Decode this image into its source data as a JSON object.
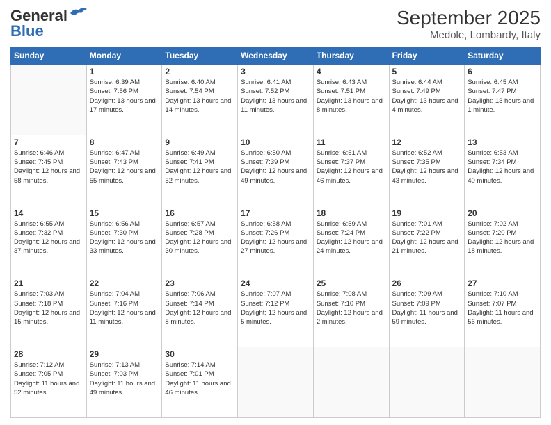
{
  "header": {
    "logo_line1": "General",
    "logo_line2": "Blue",
    "title": "September 2025",
    "subtitle": "Medole, Lombardy, Italy"
  },
  "weekdays": [
    "Sunday",
    "Monday",
    "Tuesday",
    "Wednesday",
    "Thursday",
    "Friday",
    "Saturday"
  ],
  "weeks": [
    [
      {
        "day": "",
        "sunrise": "",
        "sunset": "",
        "daylight": ""
      },
      {
        "day": "1",
        "sunrise": "Sunrise: 6:39 AM",
        "sunset": "Sunset: 7:56 PM",
        "daylight": "Daylight: 13 hours and 17 minutes."
      },
      {
        "day": "2",
        "sunrise": "Sunrise: 6:40 AM",
        "sunset": "Sunset: 7:54 PM",
        "daylight": "Daylight: 13 hours and 14 minutes."
      },
      {
        "day": "3",
        "sunrise": "Sunrise: 6:41 AM",
        "sunset": "Sunset: 7:52 PM",
        "daylight": "Daylight: 13 hours and 11 minutes."
      },
      {
        "day": "4",
        "sunrise": "Sunrise: 6:43 AM",
        "sunset": "Sunset: 7:51 PM",
        "daylight": "Daylight: 13 hours and 8 minutes."
      },
      {
        "day": "5",
        "sunrise": "Sunrise: 6:44 AM",
        "sunset": "Sunset: 7:49 PM",
        "daylight": "Daylight: 13 hours and 4 minutes."
      },
      {
        "day": "6",
        "sunrise": "Sunrise: 6:45 AM",
        "sunset": "Sunset: 7:47 PM",
        "daylight": "Daylight: 13 hours and 1 minute."
      }
    ],
    [
      {
        "day": "7",
        "sunrise": "Sunrise: 6:46 AM",
        "sunset": "Sunset: 7:45 PM",
        "daylight": "Daylight: 12 hours and 58 minutes."
      },
      {
        "day": "8",
        "sunrise": "Sunrise: 6:47 AM",
        "sunset": "Sunset: 7:43 PM",
        "daylight": "Daylight: 12 hours and 55 minutes."
      },
      {
        "day": "9",
        "sunrise": "Sunrise: 6:49 AM",
        "sunset": "Sunset: 7:41 PM",
        "daylight": "Daylight: 12 hours and 52 minutes."
      },
      {
        "day": "10",
        "sunrise": "Sunrise: 6:50 AM",
        "sunset": "Sunset: 7:39 PM",
        "daylight": "Daylight: 12 hours and 49 minutes."
      },
      {
        "day": "11",
        "sunrise": "Sunrise: 6:51 AM",
        "sunset": "Sunset: 7:37 PM",
        "daylight": "Daylight: 12 hours and 46 minutes."
      },
      {
        "day": "12",
        "sunrise": "Sunrise: 6:52 AM",
        "sunset": "Sunset: 7:35 PM",
        "daylight": "Daylight: 12 hours and 43 minutes."
      },
      {
        "day": "13",
        "sunrise": "Sunrise: 6:53 AM",
        "sunset": "Sunset: 7:34 PM",
        "daylight": "Daylight: 12 hours and 40 minutes."
      }
    ],
    [
      {
        "day": "14",
        "sunrise": "Sunrise: 6:55 AM",
        "sunset": "Sunset: 7:32 PM",
        "daylight": "Daylight: 12 hours and 37 minutes."
      },
      {
        "day": "15",
        "sunrise": "Sunrise: 6:56 AM",
        "sunset": "Sunset: 7:30 PM",
        "daylight": "Daylight: 12 hours and 33 minutes."
      },
      {
        "day": "16",
        "sunrise": "Sunrise: 6:57 AM",
        "sunset": "Sunset: 7:28 PM",
        "daylight": "Daylight: 12 hours and 30 minutes."
      },
      {
        "day": "17",
        "sunrise": "Sunrise: 6:58 AM",
        "sunset": "Sunset: 7:26 PM",
        "daylight": "Daylight: 12 hours and 27 minutes."
      },
      {
        "day": "18",
        "sunrise": "Sunrise: 6:59 AM",
        "sunset": "Sunset: 7:24 PM",
        "daylight": "Daylight: 12 hours and 24 minutes."
      },
      {
        "day": "19",
        "sunrise": "Sunrise: 7:01 AM",
        "sunset": "Sunset: 7:22 PM",
        "daylight": "Daylight: 12 hours and 21 minutes."
      },
      {
        "day": "20",
        "sunrise": "Sunrise: 7:02 AM",
        "sunset": "Sunset: 7:20 PM",
        "daylight": "Daylight: 12 hours and 18 minutes."
      }
    ],
    [
      {
        "day": "21",
        "sunrise": "Sunrise: 7:03 AM",
        "sunset": "Sunset: 7:18 PM",
        "daylight": "Daylight: 12 hours and 15 minutes."
      },
      {
        "day": "22",
        "sunrise": "Sunrise: 7:04 AM",
        "sunset": "Sunset: 7:16 PM",
        "daylight": "Daylight: 12 hours and 11 minutes."
      },
      {
        "day": "23",
        "sunrise": "Sunrise: 7:06 AM",
        "sunset": "Sunset: 7:14 PM",
        "daylight": "Daylight: 12 hours and 8 minutes."
      },
      {
        "day": "24",
        "sunrise": "Sunrise: 7:07 AM",
        "sunset": "Sunset: 7:12 PM",
        "daylight": "Daylight: 12 hours and 5 minutes."
      },
      {
        "day": "25",
        "sunrise": "Sunrise: 7:08 AM",
        "sunset": "Sunset: 7:10 PM",
        "daylight": "Daylight: 12 hours and 2 minutes."
      },
      {
        "day": "26",
        "sunrise": "Sunrise: 7:09 AM",
        "sunset": "Sunset: 7:09 PM",
        "daylight": "Daylight: 11 hours and 59 minutes."
      },
      {
        "day": "27",
        "sunrise": "Sunrise: 7:10 AM",
        "sunset": "Sunset: 7:07 PM",
        "daylight": "Daylight: 11 hours and 56 minutes."
      }
    ],
    [
      {
        "day": "28",
        "sunrise": "Sunrise: 7:12 AM",
        "sunset": "Sunset: 7:05 PM",
        "daylight": "Daylight: 11 hours and 52 minutes."
      },
      {
        "day": "29",
        "sunrise": "Sunrise: 7:13 AM",
        "sunset": "Sunset: 7:03 PM",
        "daylight": "Daylight: 11 hours and 49 minutes."
      },
      {
        "day": "30",
        "sunrise": "Sunrise: 7:14 AM",
        "sunset": "Sunset: 7:01 PM",
        "daylight": "Daylight: 11 hours and 46 minutes."
      },
      {
        "day": "",
        "sunrise": "",
        "sunset": "",
        "daylight": ""
      },
      {
        "day": "",
        "sunrise": "",
        "sunset": "",
        "daylight": ""
      },
      {
        "day": "",
        "sunrise": "",
        "sunset": "",
        "daylight": ""
      },
      {
        "day": "",
        "sunrise": "",
        "sunset": "",
        "daylight": ""
      }
    ]
  ]
}
